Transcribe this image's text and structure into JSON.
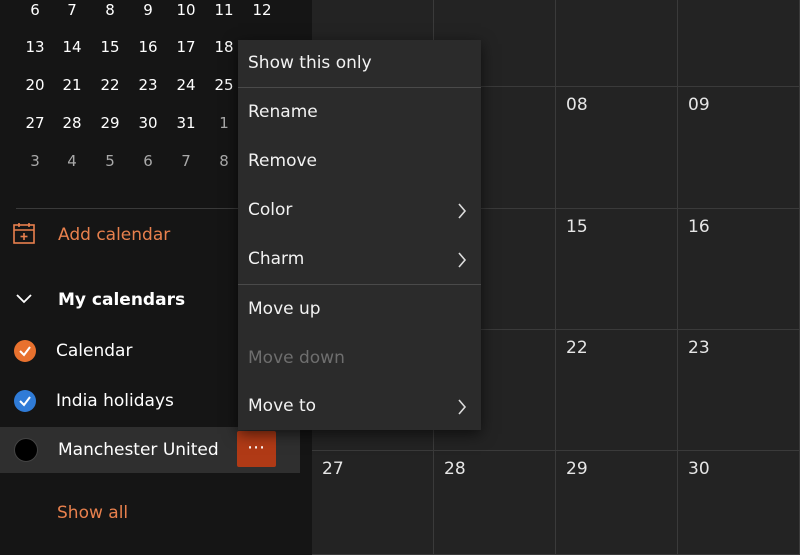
{
  "mini_calendar": {
    "rows": [
      [
        "6",
        "7",
        "8",
        "9",
        "10",
        "11",
        "12"
      ],
      [
        "13",
        "14",
        "15",
        "16",
        "17",
        "18",
        ""
      ],
      [
        "20",
        "21",
        "22",
        "23",
        "24",
        "25",
        ""
      ],
      [
        "27",
        "28",
        "29",
        "30",
        "31",
        "1",
        ""
      ],
      [
        "3",
        "4",
        "5",
        "6",
        "7",
        "8",
        ""
      ]
    ],
    "dim_from_row3_col": 5
  },
  "sidebar": {
    "add_calendar": "Add calendar",
    "section_title": "My calendars",
    "calendars": [
      {
        "label": "Calendar",
        "color": "#e8712e",
        "checked": true
      },
      {
        "label": "India holidays",
        "color": "#2f7bd7",
        "checked": true
      },
      {
        "label": "Manchester United",
        "color": "#000000",
        "checked": false
      }
    ],
    "more_button": "⋯",
    "show_all": "Show all"
  },
  "month_grid": {
    "rows": [
      [
        "",
        "",
        "",
        ""
      ],
      [
        "",
        "",
        "08",
        "09"
      ],
      [
        "",
        "",
        "15",
        "16"
      ],
      [
        "",
        "",
        "22",
        "23"
      ],
      [
        "27",
        "28",
        "29",
        "30"
      ]
    ]
  },
  "context_menu": {
    "items": [
      {
        "label": "Show this only",
        "submenu": false,
        "disabled": false
      },
      {
        "label": "Rename",
        "submenu": false,
        "disabled": false
      },
      {
        "label": "Remove",
        "submenu": false,
        "disabled": false
      },
      {
        "label": "Color",
        "submenu": true,
        "disabled": false
      },
      {
        "label": "Charm",
        "submenu": true,
        "disabled": false
      },
      {
        "label": "Move up",
        "submenu": false,
        "disabled": false
      },
      {
        "label": "Move down",
        "submenu": false,
        "disabled": true
      },
      {
        "label": "Move to",
        "submenu": true,
        "disabled": false
      }
    ]
  },
  "colors": {
    "accent": "#e8804d",
    "more_button_bg": "#b03a16"
  }
}
